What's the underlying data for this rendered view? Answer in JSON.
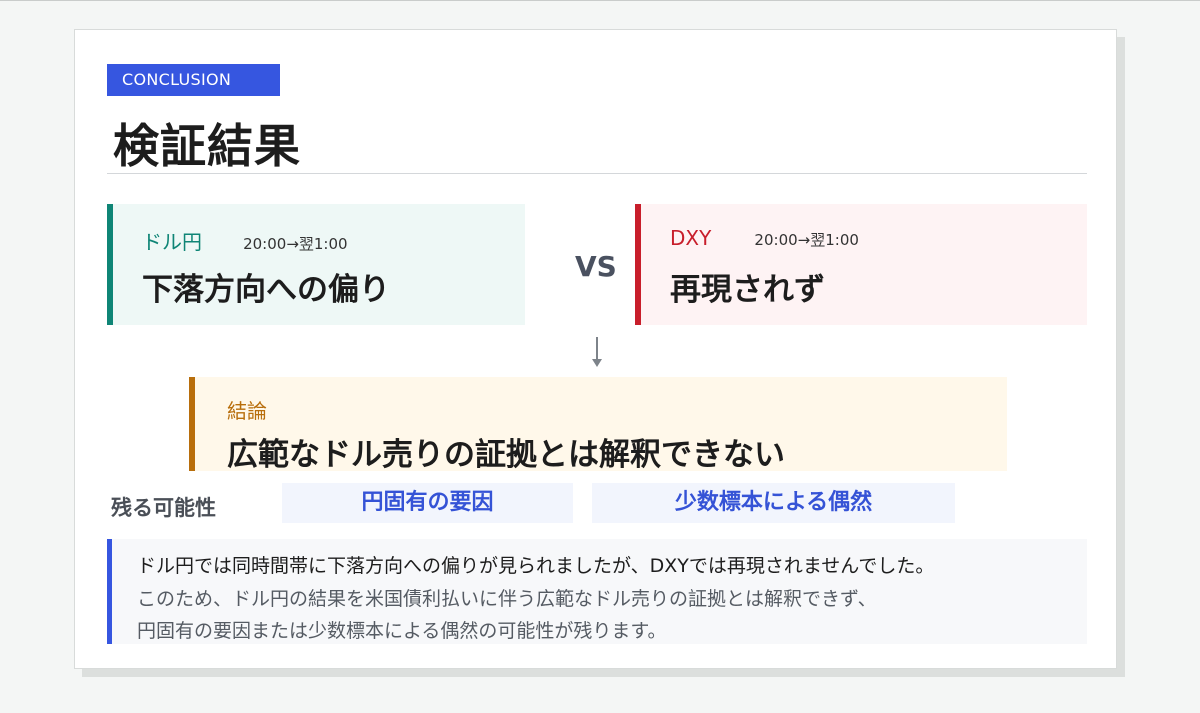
{
  "slide": {
    "tag": "CONCLUSION",
    "title": "検証結果"
  },
  "comparison": {
    "left": {
      "name": "ドル円",
      "time": "20:00→翌1:00",
      "result": "下落方向への偏り",
      "accent": "#0f8576"
    },
    "vs": "VS",
    "right": {
      "name": "DXY",
      "time": "20:00→翌1:00",
      "result": "再現されず",
      "accent": "#c81e2b"
    }
  },
  "conclusion": {
    "label": "結論",
    "text": "広範なドル売りの証拠とは解釈できない",
    "accent": "#b86e0c"
  },
  "possibilities": {
    "label": "残る可能性",
    "items": [
      "円固有の要因",
      "少数標本による偶然"
    ]
  },
  "summary": {
    "lines": [
      "ドル円では同時間帯に下落方向への偏りが見られましたが、DXYでは再現されませんでした。",
      "このため、ドル円の結果を米国債利払いに伴う広範なドル売りの証拠とは解釈できず、",
      "円固有の要因または少数標本による偶然の可能性が残ります。"
    ]
  },
  "colors": {
    "accent_blue": "#3656e0"
  }
}
